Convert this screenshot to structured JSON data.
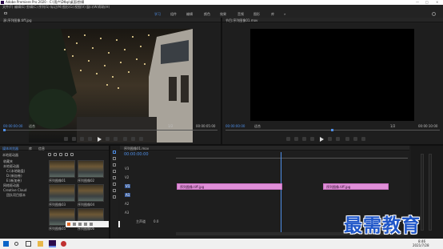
{
  "titlebar": {
    "title": "Adobe Premiere Pro 2020 - C:\\用户\\Dtbp\\桌面\\剪辑"
  },
  "menubar": {
    "items": [
      "文件(F)",
      "编辑(E)",
      "剪辑(C)",
      "序列(S)",
      "标记(M)",
      "图形(G)",
      "视图(V)",
      "窗口(W)",
      "帮助(H)"
    ]
  },
  "workspaces": {
    "tabs": [
      "学习",
      "组件",
      "编辑",
      "颜色",
      "效果",
      "音频",
      "图形",
      "库"
    ],
    "active": "学习"
  },
  "source": {
    "tab": "源:序列图像.tiff.jpg",
    "timecode_left": "00:00:00:00",
    "fit": "适合",
    "ratio": "1/2",
    "timecode_right": "00:00:05:00"
  },
  "program": {
    "tab": "节目:序列图像01.mov",
    "timecode_left": "00:00:00:00",
    "fit": "适合",
    "ratio": "1/2",
    "timecode_right": "00:00:10:00"
  },
  "project": {
    "tabs": [
      "媒体浏览器",
      "库",
      "信息"
    ],
    "root_label": "本地驱动器",
    "items": [
      "收藏夹",
      "本地驱动器",
      "C:(本地磁盘)",
      "D:(新加卷)",
      "E:(新加卷)",
      "网络驱动器",
      "Creative Cloud",
      "团队项目版本"
    ],
    "thumb_labels": [
      "序列图像01",
      "序列图像02",
      "序列图像03",
      "序列图像04",
      "序列图像05",
      "序列图像06"
    ]
  },
  "timeline": {
    "tab": "序列图像01.mov",
    "timecode": "00:00:00:00",
    "tracks": [
      "V3",
      "V2",
      "V1",
      "A1",
      "A2",
      "A3"
    ],
    "master_label": "主声道",
    "master_value": "0.0",
    "clip1_label": "序列图像.tiff.jpg",
    "clip2_label": "序列图像.tiff.jpg"
  },
  "taskbar": {
    "time": "8:46",
    "date": "2021/7/28"
  },
  "watermark": {
    "text": "最需教育"
  },
  "colors": {
    "accent": "#4f8fe8",
    "clip": "#e08fd8",
    "watermark": "#1f56c8"
  }
}
